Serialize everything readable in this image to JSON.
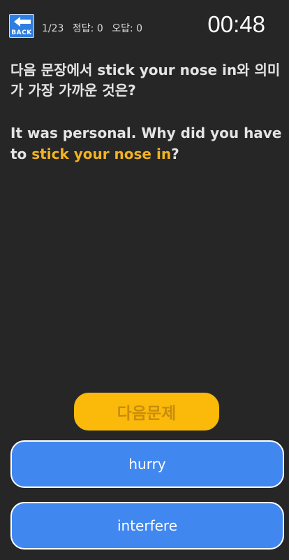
{
  "header": {
    "back_label": "BACK",
    "progress": "1/23",
    "correct": "정답: 0",
    "wrong": "오답: 0",
    "timer": "00:48"
  },
  "question": {
    "prefix": "다음 문장에서 ",
    "phrase": "stick your nose in",
    "suffix": "와 의미가 가장 가까운 것은?"
  },
  "sentence": {
    "before": "It was personal. Why did you have to ",
    "highlight": "stick your nose in",
    "after": "?"
  },
  "next_button": "다음문제",
  "options": [
    "hurry",
    "interfere"
  ],
  "colors": {
    "background": "#262626",
    "highlight": "#f3b320",
    "next_button": "#fbb90a",
    "option_button": "#4187f0",
    "back_button": "#2f7fe0"
  }
}
